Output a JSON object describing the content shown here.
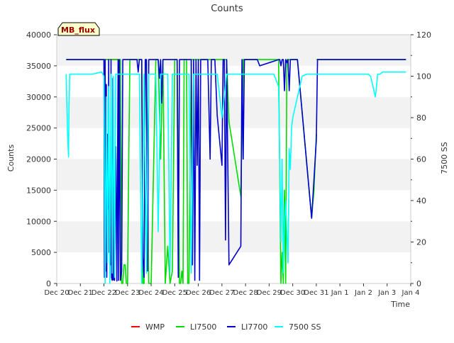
{
  "chart_data": {
    "type": "line",
    "title": "Counts",
    "badge": "MB_flux",
    "xlabel": "Time",
    "ylabel": "Counts",
    "y2label": "7500 SS",
    "ylim": [
      0,
      40000
    ],
    "y2lim": [
      0,
      120
    ],
    "y_ticks": [
      0,
      5000,
      10000,
      15000,
      20000,
      25000,
      30000,
      35000,
      40000
    ],
    "y2_ticks": [
      0,
      20,
      40,
      60,
      80,
      100,
      120
    ],
    "x_ticks": [
      "Dec 20",
      "Dec 21",
      "Dec 22",
      "Dec 23",
      "Dec 24",
      "Dec 25",
      "Dec 26",
      "Dec 27",
      "Dec 28",
      "Dec 29",
      "Dec 30",
      "Dec 31",
      "Jan 1",
      "Jan 2",
      "Jan 3",
      "Jan 4"
    ],
    "xlim": [
      0,
      15
    ],
    "grid": "horizontal bands",
    "legend_position": "bottom",
    "series": [
      {
        "name": "WMP",
        "color": "#ff0000",
        "axis": "left",
        "x": [
          2.0,
          2.6
        ],
        "y": [
          36000,
          36000
        ]
      },
      {
        "name": "LI7500",
        "color": "#00dd00",
        "axis": "left",
        "x": [
          0.4,
          2.7,
          2.75,
          2.8,
          2.85,
          2.9,
          2.95,
          3.0,
          3.05,
          3.1,
          3.2,
          3.3,
          3.6,
          3.65,
          3.7,
          3.75,
          3.8,
          3.9,
          4.0,
          4.2,
          4.3,
          4.4,
          4.5,
          4.6,
          4.7,
          4.8,
          4.9,
          5.0,
          5.1,
          5.2,
          5.25,
          5.3,
          5.35,
          5.4,
          5.45,
          5.5,
          5.55,
          5.6,
          5.7,
          7.2,
          7.3,
          7.8,
          7.9,
          8.0,
          9.4,
          9.5,
          9.55,
          9.6,
          9.65,
          9.7,
          9.75,
          9.8,
          10.0,
          10.2,
          10.8,
          10.9,
          11.0
        ],
        "y": [
          36000,
          36000,
          0,
          0,
          3000,
          3000,
          0,
          0,
          20000,
          36000,
          36000,
          36000,
          36000,
          0,
          0,
          36000,
          36000,
          0,
          0,
          36000,
          36000,
          20000,
          36000,
          0,
          6000,
          0,
          2000,
          36000,
          36000,
          0,
          0,
          2000,
          0,
          36000,
          36000,
          36000,
          0,
          0,
          36000,
          36000,
          26000,
          14000,
          36000,
          36000,
          36000,
          0,
          5000,
          0,
          15000,
          0,
          36000,
          36000,
          36000,
          36000,
          10500,
          15000,
          24000
        ]
      },
      {
        "name": "LI7500",
        "color": "#00dd00",
        "axis": "left",
        "x": [
          11.0,
          14.8
        ],
        "y": [
          36000,
          36000
        ]
      },
      {
        "name": "LI7700",
        "color": "#0000cc",
        "axis": "left",
        "x": [
          0.4,
          2.0,
          2.02,
          2.05,
          2.08,
          2.1,
          2.12,
          2.15,
          2.18,
          2.2,
          2.22,
          2.25,
          2.28,
          2.3,
          2.32,
          2.35,
          2.38,
          2.4,
          2.45,
          2.5,
          2.55,
          2.6,
          2.62,
          2.65,
          2.7,
          2.75,
          2.8,
          3.0,
          3.4,
          3.45,
          3.5,
          3.6,
          3.65,
          3.7,
          3.75,
          3.8,
          3.85,
          3.9,
          4.0,
          4.3,
          4.35,
          4.4,
          4.45,
          4.5,
          4.55,
          4.6,
          4.7,
          5.0,
          5.1,
          5.15,
          5.2,
          5.4,
          5.6,
          5.7,
          5.75,
          5.8,
          5.85,
          5.9,
          5.95,
          6.0,
          6.05,
          6.1,
          6.2,
          6.3,
          6.4,
          6.5,
          6.55,
          6.6,
          6.65,
          6.7,
          6.8,
          7.0,
          7.05,
          7.1,
          7.15,
          7.2,
          7.3,
          7.8,
          7.85,
          7.9,
          7.95,
          8.0,
          8.5,
          8.6,
          9.4,
          9.45,
          9.5,
          9.55,
          9.6,
          9.65,
          9.7,
          9.75,
          9.8,
          9.85,
          9.9,
          10.0,
          10.2,
          10.8,
          11.0,
          11.05,
          11.1,
          12.0,
          13.0,
          13.9,
          14.8
        ],
        "y": [
          36000,
          36000,
          1000,
          36000,
          2000,
          32000,
          1000,
          24000,
          12000,
          36000,
          5000,
          7000,
          3000,
          36000,
          1000,
          500,
          33000,
          600,
          500,
          22000,
          400,
          36000,
          500,
          36000,
          500,
          2000,
          36000,
          36000,
          36000,
          34000,
          36000,
          36000,
          4000,
          1000,
          36000,
          36000,
          2000,
          36000,
          36000,
          36000,
          33000,
          36000,
          29000,
          36000,
          36000,
          36000,
          36000,
          36000,
          36000,
          1000,
          36000,
          36000,
          36000,
          36000,
          3000,
          36000,
          500,
          36000,
          19000,
          36000,
          500,
          36000,
          36000,
          36000,
          36000,
          20000,
          36000,
          36000,
          36000,
          36000,
          27000,
          19000,
          36000,
          36000,
          7000,
          36000,
          3000,
          6000,
          36000,
          20000,
          36000,
          36000,
          36000,
          35000,
          36000,
          36000,
          35000,
          36000,
          36000,
          31000,
          36000,
          35500,
          36000,
          31000,
          36000,
          36000,
          36000,
          10500,
          23000,
          36000,
          36000,
          36000,
          36000,
          36000,
          36000
        ]
      },
      {
        "name": "7500 SS",
        "color": "#00ffff",
        "axis": "right",
        "x": [
          0.4,
          0.45,
          0.5,
          0.52,
          0.55,
          0.6,
          1.0,
          1.5,
          1.9,
          2.0,
          2.05,
          2.1,
          2.15,
          2.2,
          2.25,
          2.3,
          2.35,
          2.4,
          2.45,
          2.5,
          2.6,
          2.7,
          2.8,
          3.0,
          3.2,
          3.3,
          3.4,
          3.5,
          3.6,
          3.7,
          3.8,
          3.9,
          4.0,
          4.1,
          4.2,
          4.3,
          4.35,
          4.4,
          4.5,
          4.6,
          4.7,
          4.8,
          4.9,
          5.0,
          5.2,
          5.4,
          5.5,
          5.6,
          5.7,
          5.8,
          5.9,
          6.0,
          6.2,
          6.4,
          6.6,
          6.8,
          7.0,
          7.2,
          7.4,
          7.6,
          7.8,
          8.0,
          8.2,
          8.4,
          8.6,
          8.8,
          9.0,
          9.2,
          9.4,
          9.5,
          9.55,
          9.6,
          9.65,
          9.7,
          9.8,
          9.85,
          9.9,
          9.95,
          10.0,
          10.2,
          10.4,
          10.6,
          10.8,
          11.0,
          11.5,
          12.0,
          12.5,
          13.0,
          13.2,
          13.3,
          13.4,
          13.5,
          13.55,
          13.6,
          13.7,
          13.8,
          14.0,
          14.2,
          14.3,
          14.4,
          14.5,
          14.6,
          14.7,
          14.8
        ],
        "y": [
          101,
          75,
          61,
          85,
          101,
          101,
          101,
          101,
          102,
          100,
          0,
          90,
          10,
          95,
          0,
          101,
          5,
          100,
          3,
          101,
          101,
          101,
          101,
          101,
          101,
          101,
          101,
          101,
          0,
          101,
          5,
          101,
          101,
          101,
          101,
          25,
          60,
          101,
          101,
          101,
          101,
          5,
          101,
          101,
          101,
          101,
          101,
          101,
          5,
          101,
          101,
          101,
          101,
          101,
          101,
          101,
          80,
          101,
          101,
          101,
          101,
          101,
          101,
          101,
          101,
          101,
          101,
          101,
          95,
          20,
          60,
          5,
          30,
          40,
          10,
          65,
          55,
          75,
          80,
          90,
          100,
          101,
          101,
          101,
          101,
          101,
          101,
          101,
          101,
          100,
          95,
          90,
          95,
          101,
          101,
          102,
          102,
          102,
          102,
          102,
          102,
          102,
          102,
          102
        ]
      }
    ]
  }
}
